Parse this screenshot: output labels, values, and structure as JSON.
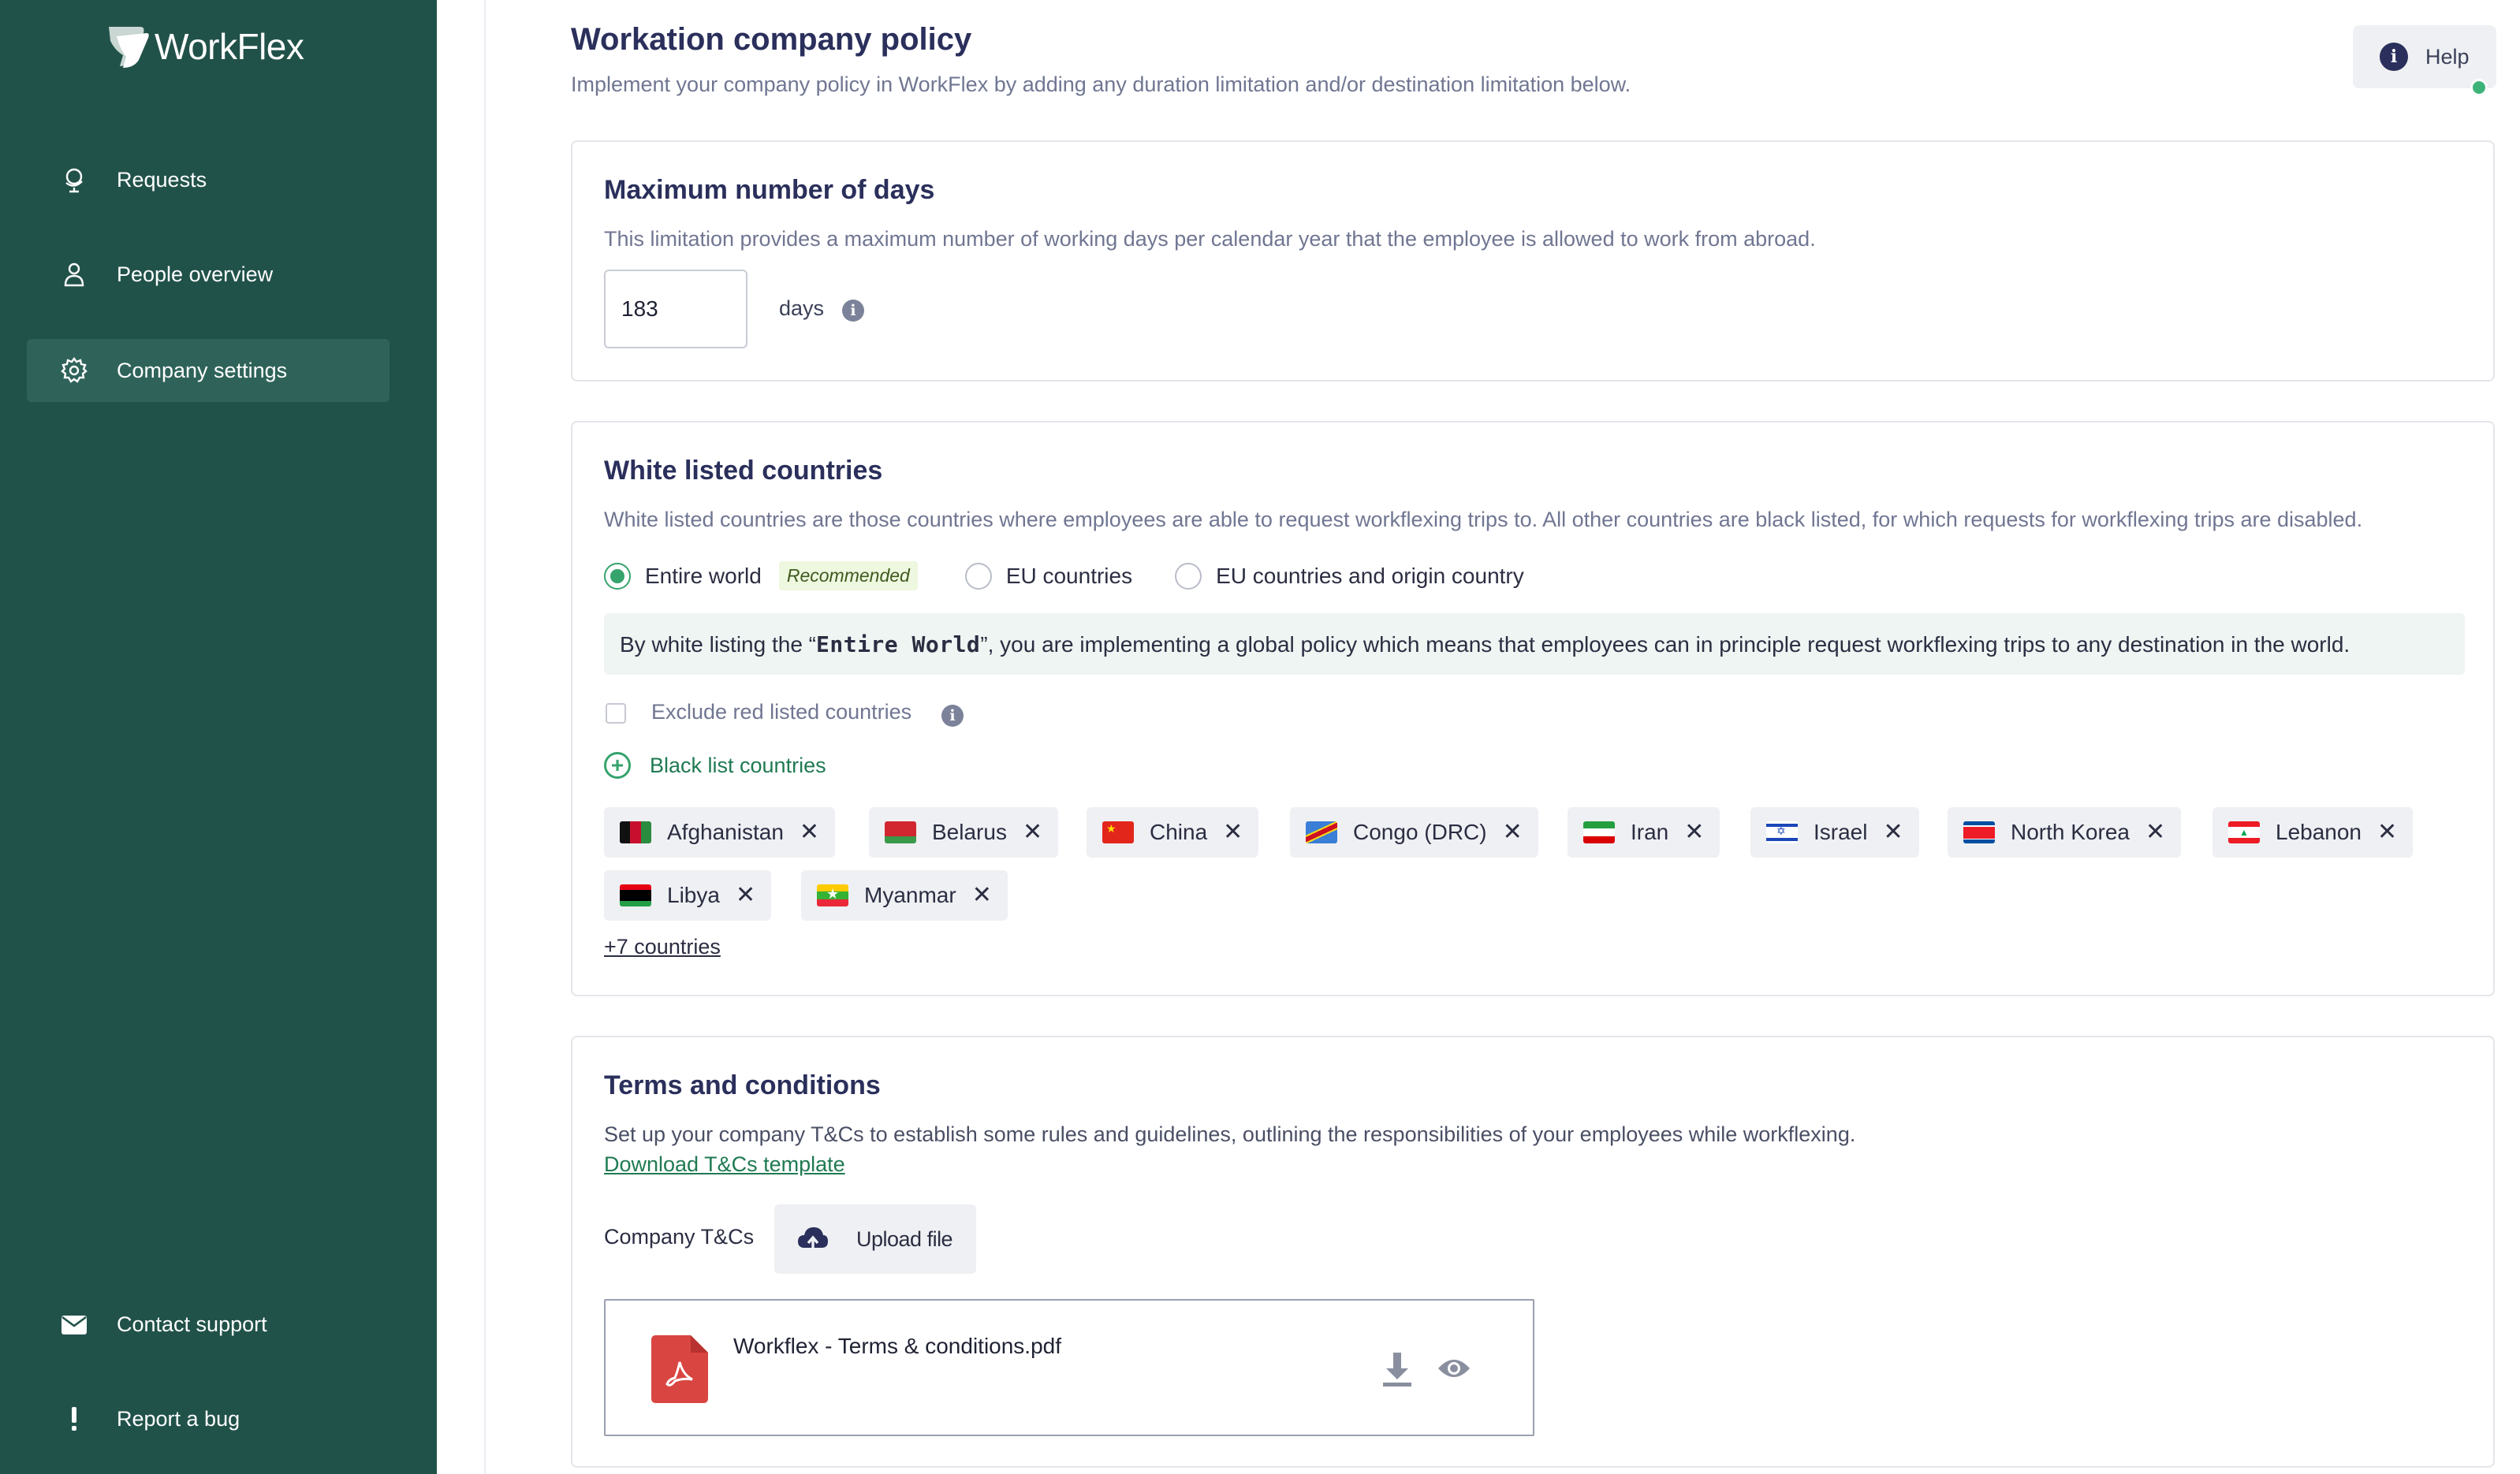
{
  "app": {
    "name": "WorkFlex"
  },
  "sidebar": {
    "items": [
      {
        "label": "Requests",
        "icon": "globe-stand-icon",
        "active": false
      },
      {
        "label": "People overview",
        "icon": "person-icon",
        "active": false
      },
      {
        "label": "Company settings",
        "icon": "gear-icon",
        "active": true
      }
    ],
    "bottom": [
      {
        "label": "Contact support",
        "icon": "envelope-icon"
      },
      {
        "label": "Report a bug",
        "icon": "exclamation-icon"
      }
    ]
  },
  "header": {
    "title": "Workation company policy",
    "subtitle": "Implement your company policy in WorkFlex by adding any duration limitation and/or destination limitation below.",
    "help_label": "Help"
  },
  "max_days": {
    "title": "Maximum number of days",
    "description": "This limitation provides a maximum number of working days per calendar year that the employee is allowed to work from abroad.",
    "value": "183",
    "unit_label": "days"
  },
  "whitelist": {
    "title": "White listed countries",
    "description": "White listed countries are those countries where employees are able to request workflexing trips to. All other countries are black listed, for which requests for workflexing trips are disabled.",
    "options": [
      {
        "label": "Entire world",
        "selected": true,
        "badge": "Recommended"
      },
      {
        "label": "EU countries",
        "selected": false
      },
      {
        "label": "EU countries and origin country",
        "selected": false
      }
    ],
    "banner": {
      "before": "By white listing the “",
      "highlight": "Entire World",
      "after": "”, you are implementing a global policy which means that employees can in principle request workflexing trips to any destination in the world."
    },
    "exclude_label": "Exclude red listed countries",
    "exclude_checked": false,
    "blacklist_label": "Black list countries",
    "blacklisted": [
      {
        "name": "Afghanistan"
      },
      {
        "name": "Belarus"
      },
      {
        "name": "China"
      },
      {
        "name": "Congo (DRC)"
      },
      {
        "name": "Iran"
      },
      {
        "name": "Israel"
      },
      {
        "name": "North Korea"
      },
      {
        "name": "Lebanon"
      },
      {
        "name": "Libya"
      },
      {
        "name": "Myanmar"
      }
    ],
    "more_label": "+7 countries"
  },
  "terms": {
    "title": "Terms and conditions",
    "description": "Set up your company T&Cs to establish some rules and guidelines, outlining the responsibilities of your employees while workflexing.",
    "template_link": "Download T&Cs template",
    "field_label": "Company T&Cs",
    "upload_label": "Upload file",
    "file_name": "Workflex - Terms & conditions.pdf"
  },
  "colors": {
    "sidebar_bg": "#21524a",
    "sidebar_active": "#2f6359",
    "accent_green": "#35a36c",
    "title_navy": "#2a2f5b",
    "pdf_red": "#d94541"
  }
}
